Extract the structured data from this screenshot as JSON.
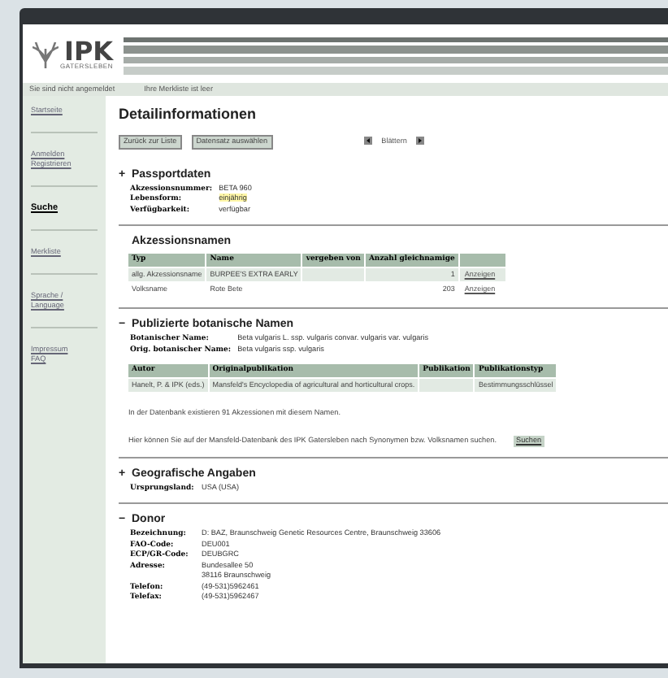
{
  "logo": {
    "name": "IPK",
    "subtitle": "GATERSLEBEN"
  },
  "status_bar": [
    "Sie sind nicht angemeldet",
    "Ihre Merkliste ist leer"
  ],
  "sidebar": {
    "items": [
      {
        "lines": [
          "Startseite"
        ],
        "selected": false
      },
      {
        "lines": [
          "Anmelden",
          "Registrieren"
        ],
        "selected": false
      },
      {
        "lines": [
          "Suche"
        ],
        "selected": true
      },
      {
        "lines": [
          "Merkliste"
        ],
        "selected": false
      },
      {
        "lines": [
          "Sprache /",
          "Language"
        ],
        "selected": false
      },
      {
        "lines": [
          "Impressum",
          "FAQ"
        ],
        "selected": false
      }
    ]
  },
  "page_title": "Detailinformationen",
  "buttons": [
    "Zurück zur Liste",
    "Datensatz auswählen"
  ],
  "pager": {
    "label": "Blättern"
  },
  "sections": [
    {
      "sign": "+",
      "title": "Passportdaten",
      "fields": [
        {
          "label": "Akzessionsnummer:",
          "value": "BETA 960",
          "highlighted": false
        },
        {
          "label": "Lebensform:",
          "value": "einjährig",
          "highlighted": true
        },
        {
          "label": "Verfügbarkeit:",
          "value": "verfügbar",
          "highlighted": false
        }
      ]
    },
    {
      "title": "Akzessionsnamen",
      "table": {
        "columns": [
          {
            "label": "Typ"
          },
          {
            "label": "Name"
          },
          {
            "label": "vergeben von"
          },
          {
            "label": "Anzahl gleichnamige"
          }
        ],
        "rows": [
          {
            "cells": [
              "allg. Akzessionsname",
              "BURPEE'S EXTRA EARLY",
              null,
              "1"
            ],
            "link": "Anzeigen"
          },
          {
            "cells": [
              "Volksname",
              "Rote Bete",
              null,
              "203"
            ],
            "link": "Anzeigen"
          }
        ]
      }
    },
    {
      "sign": "−",
      "title": "Publizierte botanische Namen",
      "fields": [
        {
          "label": "Botanischer Name:",
          "value": "Beta vulgaris L. ssp. vulgaris convar. vulgaris var. vulgaris"
        },
        {
          "label": "Orig. botanischer Name:",
          "value": "Beta vulgaris ssp. vulgaris"
        }
      ],
      "table": {
        "columns": [
          {
            "label": "Autor"
          },
          {
            "label": "Originalpublikation"
          },
          {
            "label": "Publikation"
          },
          {
            "label": "Publikationstyp"
          }
        ],
        "rows": [
          {
            "cells": [
              "Hanelt, P. & IPK (eds.)",
              "Mansfeld's Encyclopedia of agricultural and horticultural crops.",
              null,
              "Bestimmungsschlüssel"
            ]
          }
        ]
      },
      "notes": [
        "In der Datenbank existieren 91 Akzessionen mit diesem Namen."
      ],
      "search": {
        "text": "Hier können Sie auf der Mansfeld-Datenbank des IPK Gatersleben nach Synonymen bzw. Volksnamen suchen.",
        "button": "Suchen"
      }
    },
    {
      "sign": "+",
      "title": "Geografische Angaben",
      "fields": [
        {
          "label": "Ursprungsland:",
          "value": "USA (USA)"
        }
      ]
    },
    {
      "sign": "−",
      "title": "Donor",
      "fields": [
        {
          "label": "Bezeichnung:",
          "value": "D: BAZ, Braunschweig Genetic Resources Centre, Braunschweig 33606"
        },
        {
          "label": "FAO-Code:",
          "value": "DEU001"
        },
        {
          "label": "ECP/GR-Code:",
          "value": "DEUBGRC"
        },
        {
          "label": "Adresse:",
          "value": "Bundesallee 50"
        },
        {
          "value": "38116 Braunschweig"
        },
        {
          "label": "Telefon:",
          "value": "(49-531)5962461"
        },
        {
          "label": "Telefax:",
          "value": "(49-531)5962467"
        }
      ]
    }
  ]
}
